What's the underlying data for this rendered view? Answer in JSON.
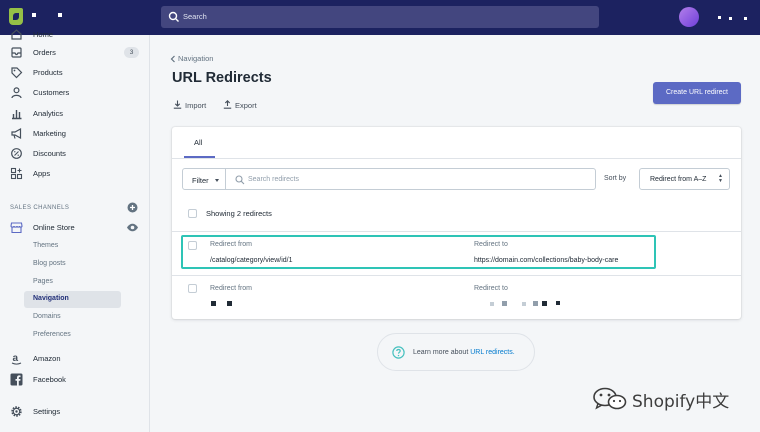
{
  "topbar": {
    "search_placeholder": "Search"
  },
  "sidebar": {
    "home": "Home",
    "orders": "Orders",
    "orders_badge": "3",
    "products": "Products",
    "customers": "Customers",
    "analytics": "Analytics",
    "marketing": "Marketing",
    "discounts": "Discounts",
    "apps": "Apps",
    "sales_channels_label": "SALES CHANNELS",
    "online_store": "Online Store",
    "sub_items": [
      "Themes",
      "Blog posts",
      "Pages",
      "Navigation",
      "Domains",
      "Preferences"
    ],
    "amazon": "Amazon",
    "facebook": "Facebook",
    "settings": "Settings"
  },
  "main": {
    "breadcrumb": "Navigation",
    "title": "URL Redirects",
    "import_label": "Import",
    "export_label": "Export",
    "create_button": "Create URL redirect",
    "tab_all": "All",
    "filter_label": "Filter",
    "search_placeholder": "Search redirects",
    "sort_label": "Sort by",
    "sort_value": "Redirect from A–Z",
    "showing": "Showing 2 redirects",
    "rows": [
      {
        "from_label": "Redirect from",
        "to_label": "Redirect to",
        "from_value": "/catalog/category/view/id/1",
        "to_value": "https://domain.com/collections/baby-body-care"
      },
      {
        "from_label": "Redirect from",
        "to_label": "Redirect to"
      }
    ],
    "learn_prefix": "Learn more about ",
    "learn_link": "URL redirects."
  },
  "watermark": "Shopify中文",
  "colors": {
    "topbar": "#1c2260",
    "primary": "#5c6ac4",
    "highlight": "#2ec4b6",
    "link": "#007ace"
  }
}
